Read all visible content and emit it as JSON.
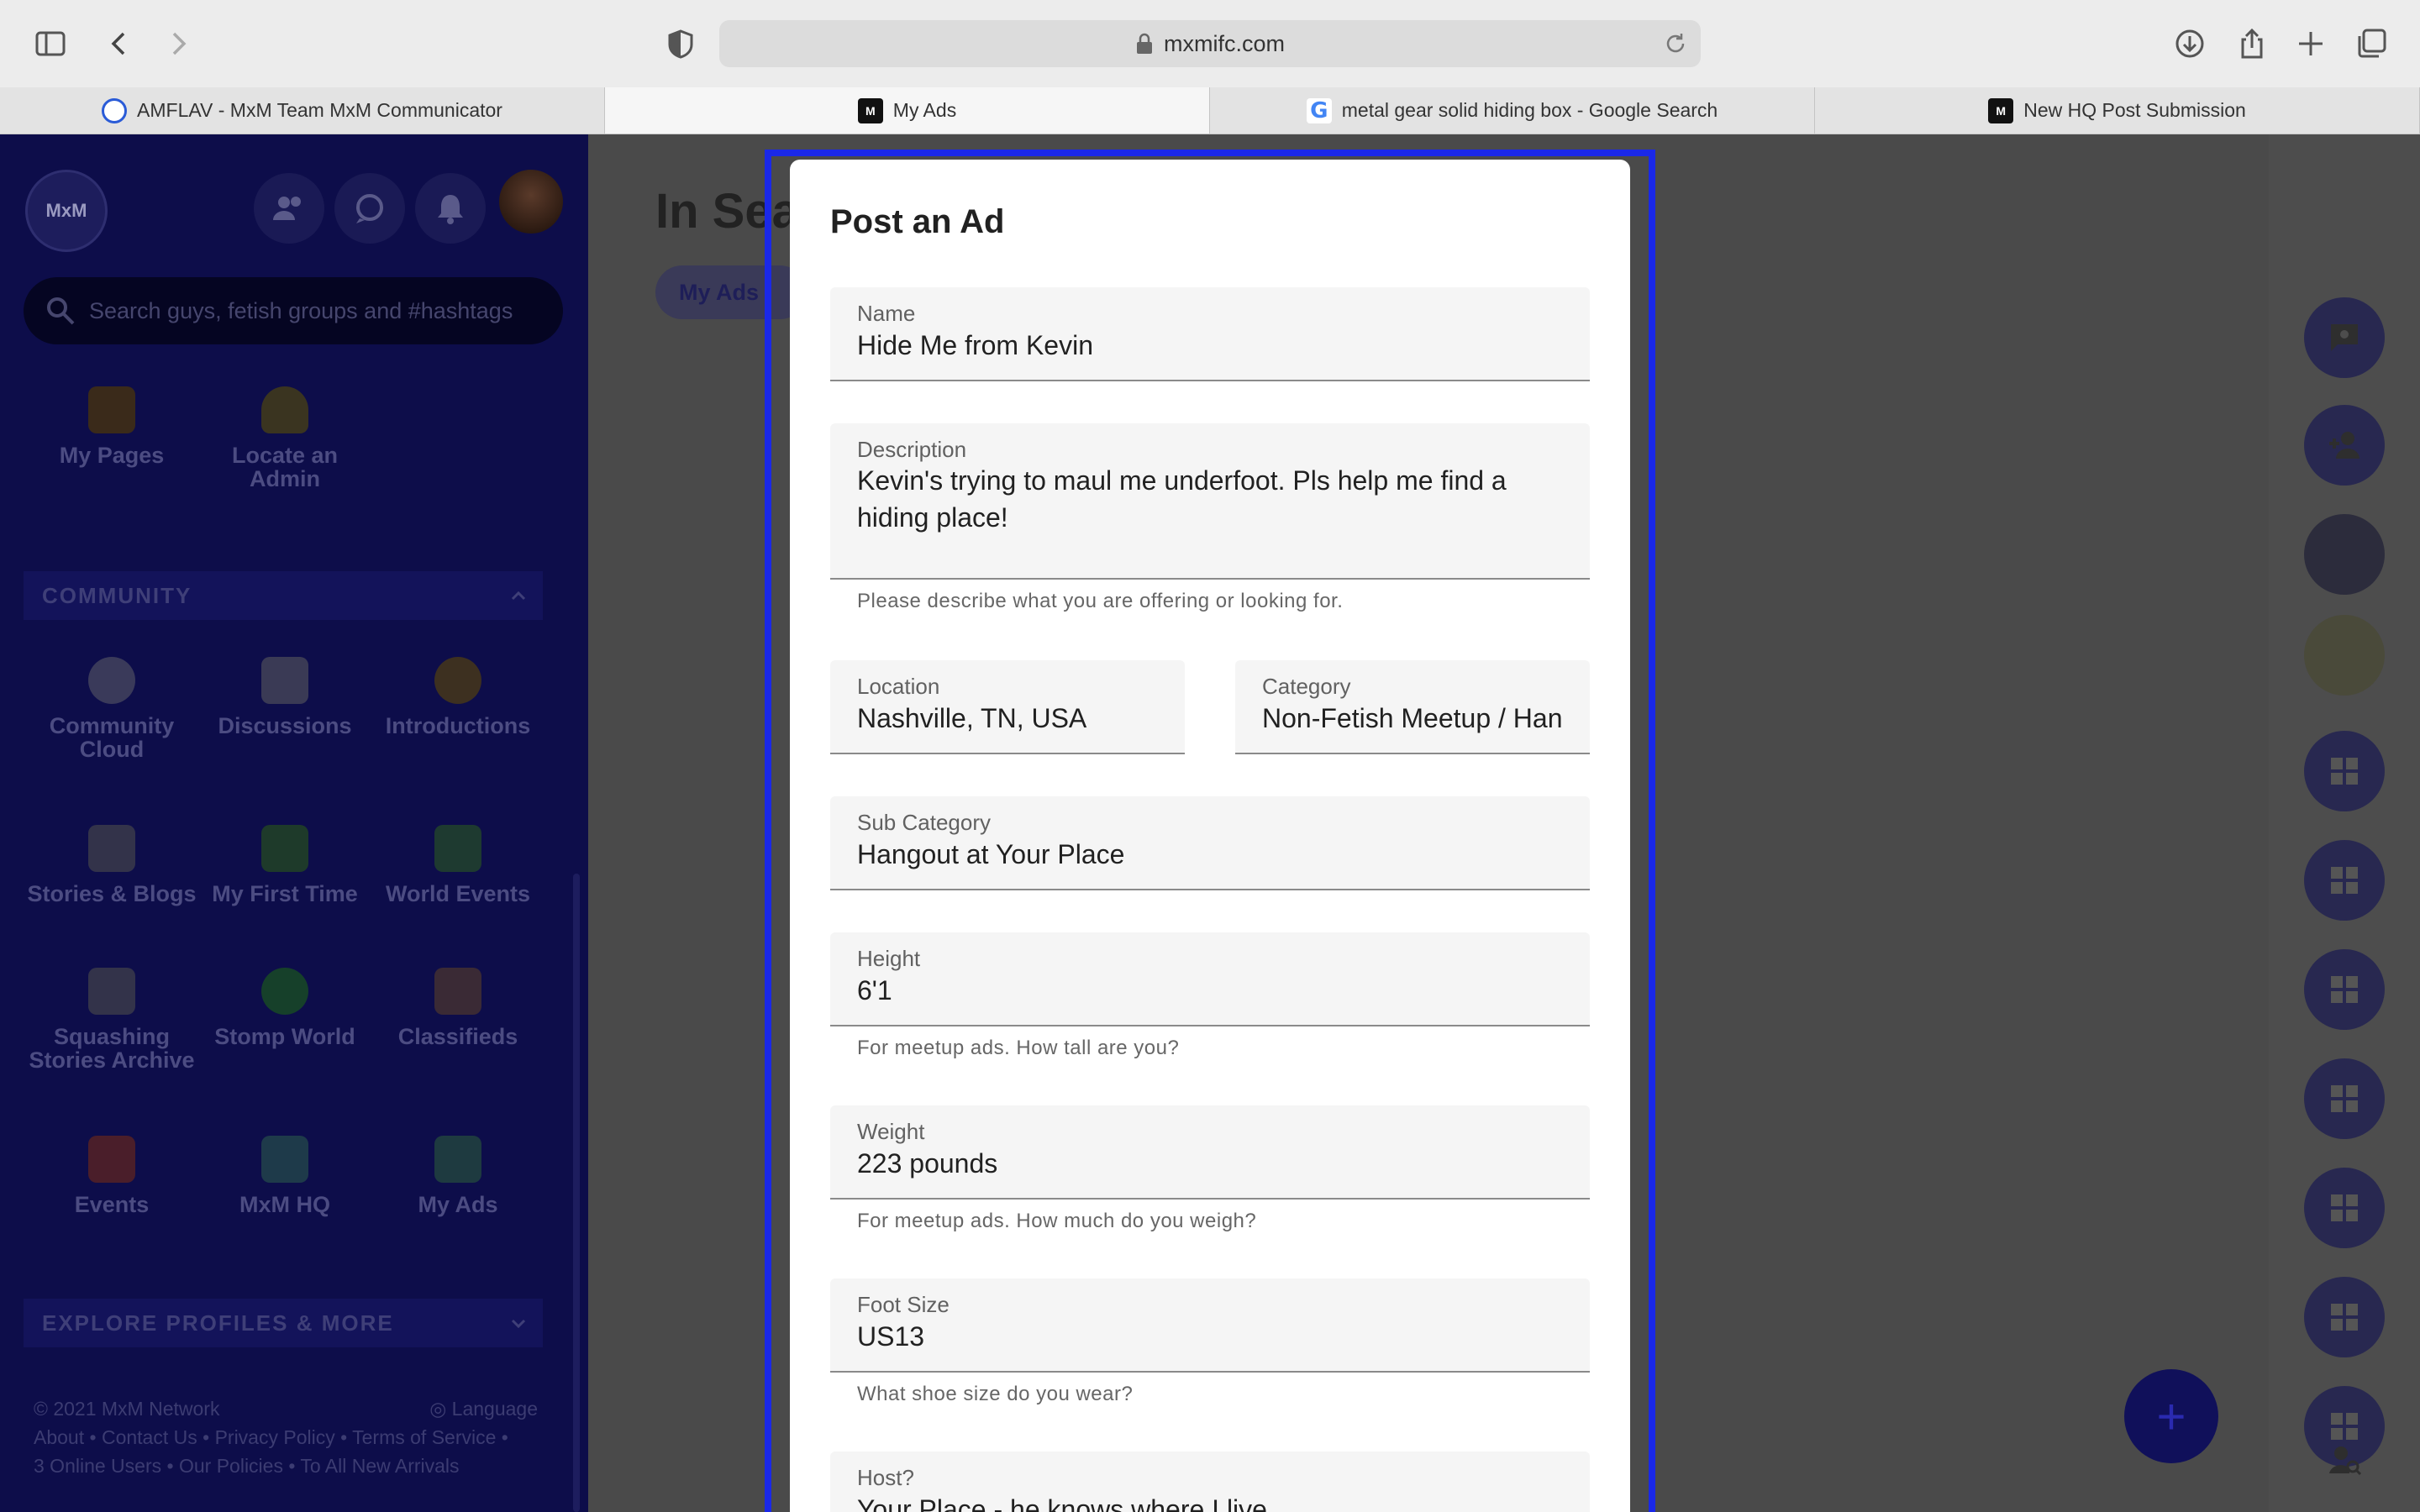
{
  "browser": {
    "url": "mxmifc.com",
    "tabs": [
      {
        "label": "AMFLAV - MxM Team MxM Communicator"
      },
      {
        "label": "My Ads"
      },
      {
        "label": "metal gear solid hiding box - Google Search"
      },
      {
        "label": "New HQ Post Submission"
      }
    ]
  },
  "sidebar": {
    "logo_text": "MxM",
    "search_placeholder": "Search guys, fetish groups and #hashtags",
    "top_items": [
      {
        "label": "My Pages"
      },
      {
        "label": "Locate an Admin"
      }
    ],
    "community_header": "COMMUNITY",
    "community_items": [
      {
        "label": "Community Cloud"
      },
      {
        "label": "Discussions"
      },
      {
        "label": "Introductions"
      },
      {
        "label": "Stories & Blogs"
      },
      {
        "label": "My First Time"
      },
      {
        "label": "World Events"
      },
      {
        "label": "Squashing Stories Archive"
      },
      {
        "label": "Stomp World"
      },
      {
        "label": "Classifieds"
      },
      {
        "label": "Events"
      },
      {
        "label": "MxM HQ"
      },
      {
        "label": "My Ads"
      }
    ],
    "explore_header": "EXPLORE PROFILES & MORE",
    "footer": {
      "copyright": "© 2021 MxM Network",
      "language": "Language",
      "links": [
        "About",
        "Contact Us",
        "Privacy Policy",
        "Terms of Service"
      ],
      "online": "3 Online Users",
      "links2": [
        "Our Policies",
        "To All New Arrivals"
      ]
    }
  },
  "main": {
    "title_partial": "In Sear",
    "chip_partial": "My Ads"
  },
  "modal": {
    "title": "Post an Ad",
    "name": {
      "label": "Name",
      "value": "Hide Me from Kevin"
    },
    "description": {
      "label": "Description",
      "value": "Kevin's trying to maul me underfoot. Pls help me find a hiding place!",
      "hint": "Please describe what you are offering or looking for."
    },
    "location": {
      "label": "Location",
      "value": "Nashville, TN, USA"
    },
    "category": {
      "label": "Category",
      "value": "Non-Fetish Meetup / Hangout"
    },
    "sub_category": {
      "label": "Sub Category",
      "value": "Hangout at Your Place"
    },
    "height": {
      "label": "Height",
      "value": "6'1",
      "hint": "For meetup ads. How tall are you?"
    },
    "weight": {
      "label": "Weight",
      "value": "223 pounds",
      "hint": "For meetup ads. How much do you weigh?"
    },
    "foot_size": {
      "label": "Foot Size",
      "value": "US13",
      "hint": "What shoe size do you wear?"
    },
    "host": {
      "label": "Host?",
      "value": "Your Place - he knows where I live"
    }
  },
  "colors": {
    "highlight": "#1a28e8",
    "sidebar_bg": "#0d0d4a",
    "overlay": "#4a4a4a"
  }
}
